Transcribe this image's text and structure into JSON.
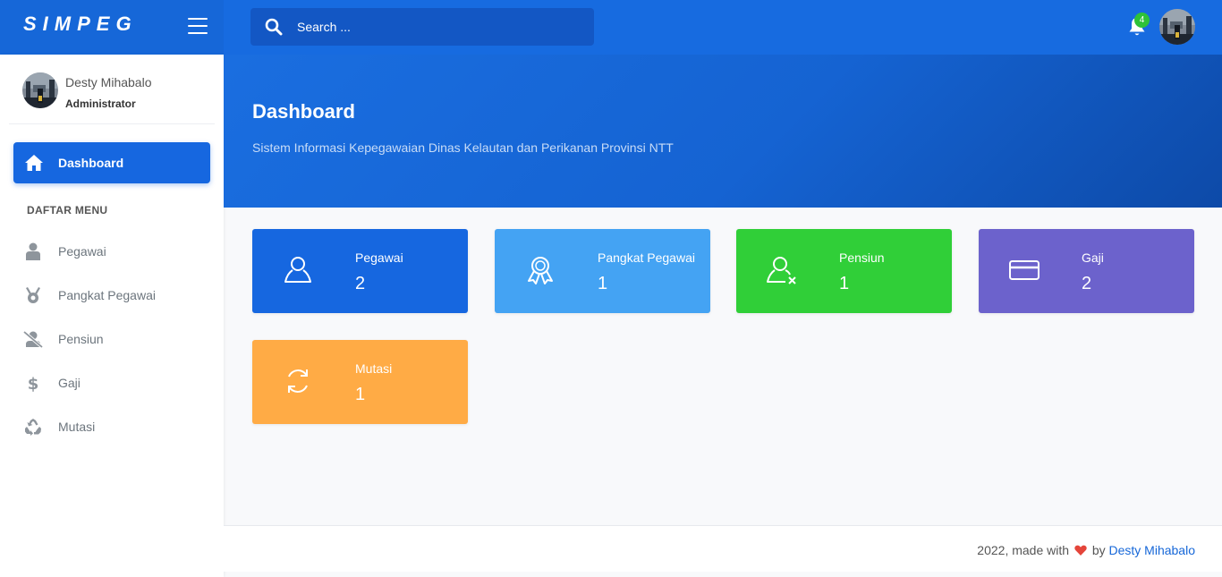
{
  "app": {
    "logo": "SIMPEG"
  },
  "search": {
    "placeholder": "Search ..."
  },
  "notifications": {
    "count": "4"
  },
  "user": {
    "name": "Desty Mihabalo",
    "role": "Administrator"
  },
  "sidebar": {
    "active": {
      "label": "Dashboard",
      "icon": "home-icon"
    },
    "heading": "DAFTAR MENU",
    "items": [
      {
        "label": "Pegawai",
        "icon": "user-icon"
      },
      {
        "label": "Pangkat Pegawai",
        "icon": "medal-icon"
      },
      {
        "label": "Pensiun",
        "icon": "user-slash-icon"
      },
      {
        "label": "Gaji",
        "icon": "dollar-icon"
      },
      {
        "label": "Mutasi",
        "icon": "recycle-icon"
      }
    ]
  },
  "header": {
    "title": "Dashboard",
    "subtitle": "Sistem Informasi Kepegawaian Dinas Kelautan dan Perikanan Provinsi NTT"
  },
  "cards": [
    {
      "label": "Pegawai",
      "value": "2",
      "color": "#1667e0",
      "icon": "user-outline-icon"
    },
    {
      "label": "Pangkat Pegawai",
      "value": "1",
      "color": "#44a3f3",
      "icon": "award-icon"
    },
    {
      "label": "Pensiun",
      "value": "1",
      "color": "#30cf38",
      "icon": "user-x-icon"
    },
    {
      "label": "Gaji",
      "value": "2",
      "color": "#6c62cc",
      "icon": "credit-card-icon"
    },
    {
      "label": "Mutasi",
      "value": "1",
      "color": "#ffab45",
      "icon": "refresh-icon"
    }
  ],
  "footer": {
    "prefix": "2022, made with",
    "middle": "by",
    "author": "Desty Mihabalo"
  },
  "colors": {
    "primary": "#1667d8",
    "sidebar_active": "#1667e0",
    "badge": "#2ec239",
    "heart": "#e4453a"
  }
}
